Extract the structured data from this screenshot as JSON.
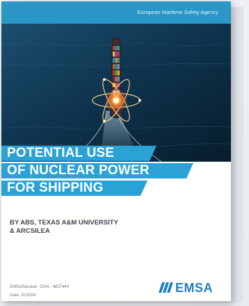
{
  "cover": {
    "agency": "European Maritime Safety Agency",
    "title_lines": [
      "POTENTIAL USE",
      "OF NUCLEAR POWER",
      "FOR SHIPPING"
    ],
    "authors_lines": [
      "BY ABS, TEXAS A&M UNIVERSITY",
      "& ARCSILEA"
    ],
    "reference": "EMSA/Nuclear- 2024 - 4837444",
    "date": "Date: 11/2024",
    "logo": "EMSA"
  },
  "colors": {
    "accent_blue": "#2aa2d6",
    "logo_blue": "#1f7fc0",
    "sea_dark": "#0b2a3f"
  },
  "icons": {
    "cover_image": "container-ship-with-atom-icon",
    "logo_mark": "emsa-logo-stripes-icon"
  }
}
